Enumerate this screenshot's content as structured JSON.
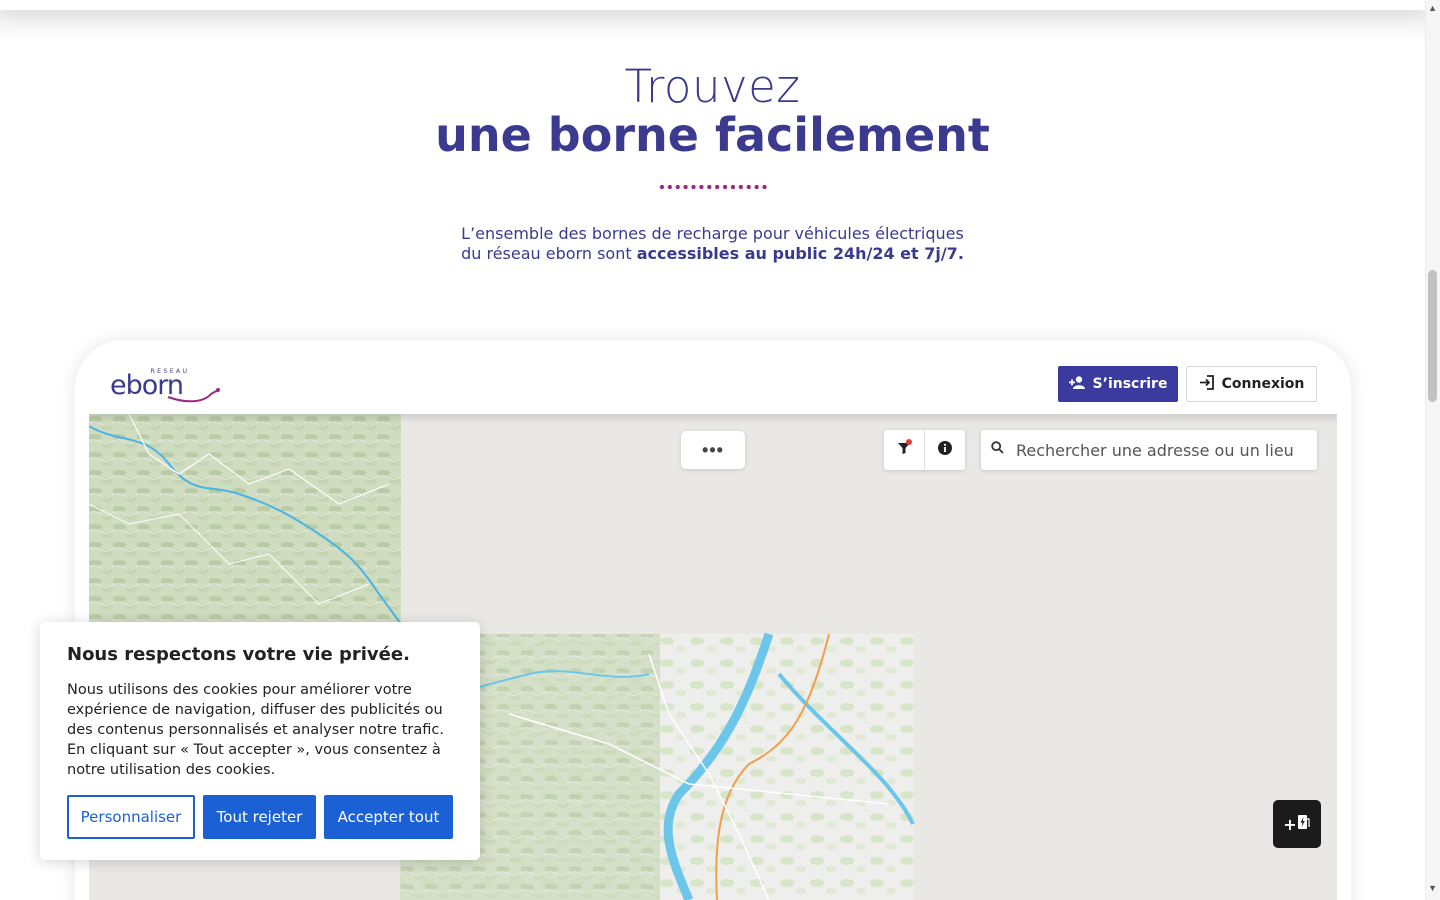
{
  "hero": {
    "title_light": "Trouvez",
    "title_bold": "une borne facilement",
    "description_line1": "L’ensemble des bornes de recharge pour véhicules électriques",
    "description_line2_prefix": "du réseau eborn sont ",
    "description_line2_bold": "accessibles au public 24h/24 et 7j/7."
  },
  "app": {
    "logo_small": "RESEAU",
    "logo_main": "eborn",
    "signup_label": "S’inscrire",
    "login_label": "Connexion"
  },
  "map": {
    "more_label": "•••",
    "search_placeholder": "Rechercher une adresse ou un lieu",
    "add_station_label": "+",
    "icons": [
      "filter-icon",
      "info-icon",
      "search-icon",
      "charging-station-icon",
      "user-plus-icon",
      "login-icon"
    ]
  },
  "cookie": {
    "title": "Nous respectons votre vie privée.",
    "text": "Nous utilisons des cookies pour améliorer votre expérience de navigation, diffuser des publicités ou des contenus personnalisés et analyser notre trafic. En cliquant sur « Tout accepter », vous consentez à notre utilisation des cookies.",
    "customize_label": "Personnaliser",
    "reject_label": "Tout rejeter",
    "accept_label": "Accepter tout"
  },
  "colors": {
    "brand": "#3b3a9f",
    "brand_text": "#3b3a8f",
    "accent_dots": "#9a2a7f",
    "cookie_blue": "#1c60d6"
  }
}
